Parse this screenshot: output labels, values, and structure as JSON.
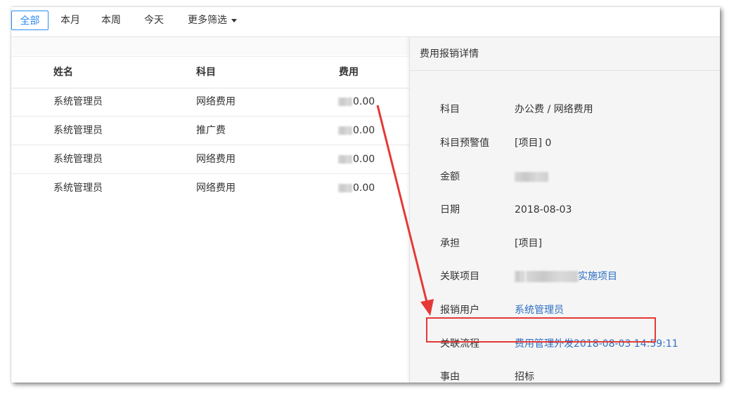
{
  "filters": {
    "all": "全部",
    "month": "本月",
    "week": "本周",
    "today": "今天",
    "more": "更多筛选"
  },
  "table": {
    "headers": {
      "name": "姓名",
      "subject": "科目",
      "cost": "费用"
    },
    "rows": [
      {
        "name": "系统管理员",
        "subject": "网络费用",
        "cost_suffix": "0.00"
      },
      {
        "name": "系统管理员",
        "subject": "推广费",
        "cost_suffix": "0.00"
      },
      {
        "name": "系统管理员",
        "subject": "网络费用",
        "cost_suffix": "0.00"
      },
      {
        "name": "系统管理员",
        "subject": "网络费用",
        "cost_suffix": "0.00"
      }
    ]
  },
  "detail": {
    "title": "费用报销详情",
    "fields": {
      "subject_label": "科目",
      "subject_value": "办公费 / 网络费用",
      "warning_label": "科目预警值",
      "warning_value": "[项目] 0",
      "amount_label": "金额",
      "date_label": "日期",
      "date_value": "2018-08-03",
      "bearer_label": "承担",
      "bearer_value": "[项目]",
      "project_label": "关联项目",
      "project_value_suffix": "实施项目",
      "user_label": "报销用户",
      "user_value": "系统管理员",
      "flow_label": "关联流程",
      "flow_value": "费用管理外发2018-08-03 14:59:11",
      "reason_label": "事由",
      "reason_value": "招标"
    }
  },
  "colors": {
    "accent": "#2d8cf0",
    "link": "#2d6fc4",
    "annotation_red": "#e53935"
  }
}
